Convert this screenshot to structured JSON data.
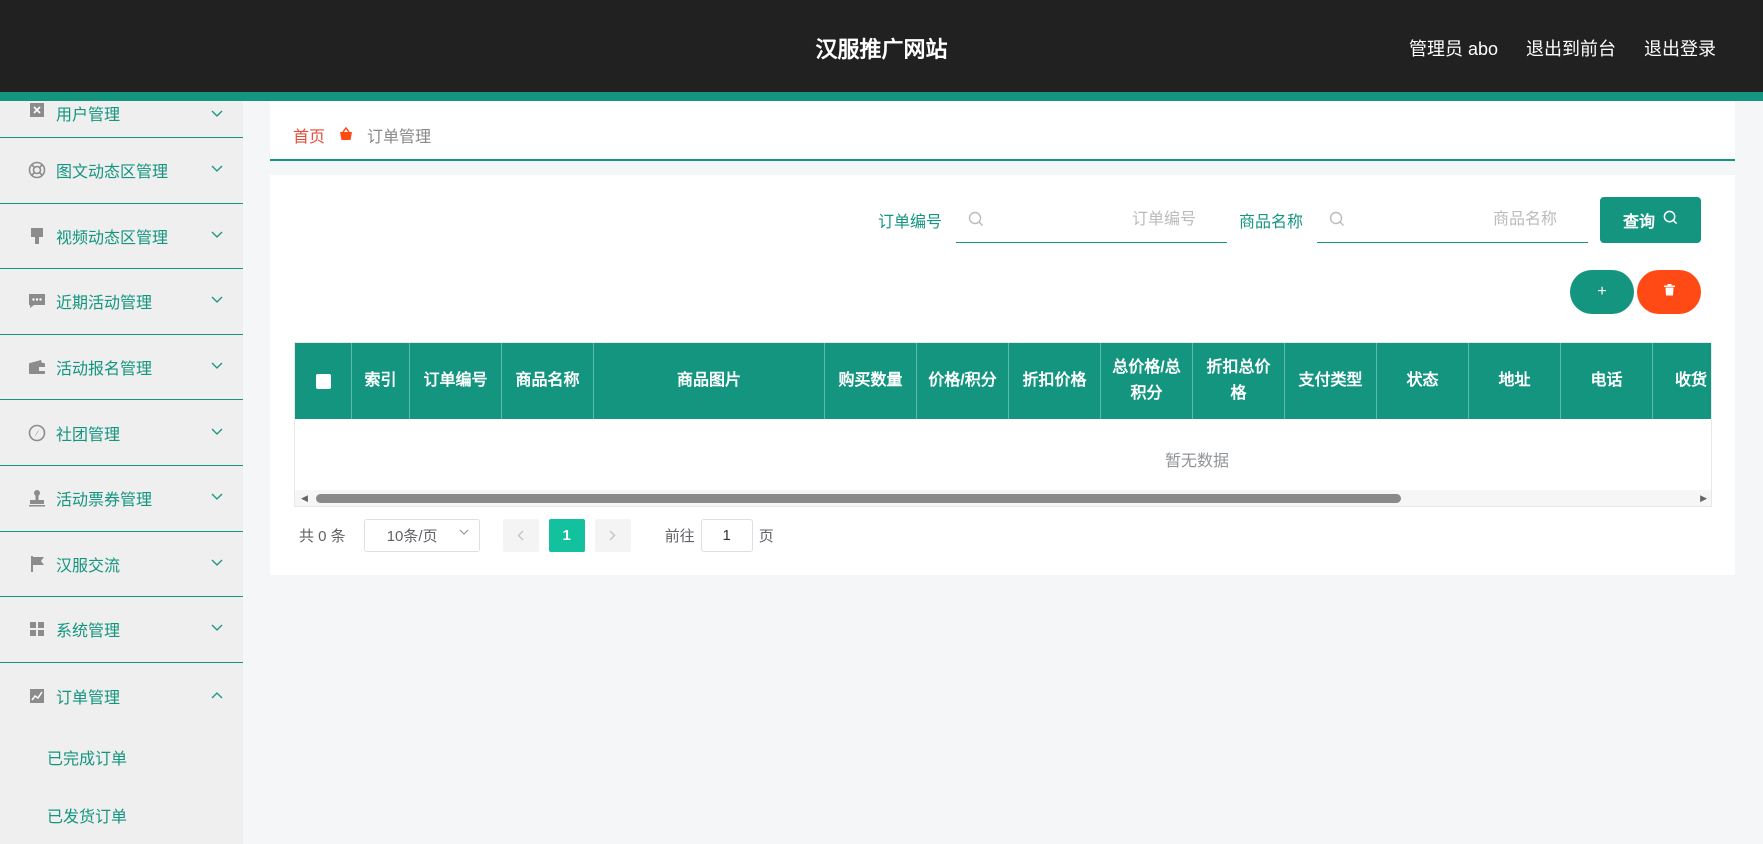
{
  "header": {
    "title": "汉服推广网站",
    "admin_label": "管理员 abo",
    "exit_front_label": "退出到前台",
    "logout_label": "退出登录"
  },
  "sidebar": {
    "items": [
      {
        "label": "用户管理",
        "icon": "user-box-icon",
        "expanded": false
      },
      {
        "label": "图文动态区管理",
        "icon": "lifebuoy-icon",
        "expanded": false
      },
      {
        "label": "视频动态区管理",
        "icon": "brush-icon",
        "expanded": false
      },
      {
        "label": "近期活动管理",
        "icon": "chat-icon",
        "expanded": false
      },
      {
        "label": "活动报名管理",
        "icon": "wallet-icon",
        "expanded": false
      },
      {
        "label": "社团管理",
        "icon": "compass-icon",
        "expanded": false
      },
      {
        "label": "活动票券管理",
        "icon": "stamp-icon",
        "expanded": false
      },
      {
        "label": "汉服交流",
        "icon": "flag-icon",
        "expanded": false
      },
      {
        "label": "系统管理",
        "icon": "grid-icon",
        "expanded": false
      },
      {
        "label": "订单管理",
        "icon": "trend-chart-icon",
        "expanded": true
      }
    ],
    "subitems": [
      {
        "label": "已完成订单"
      },
      {
        "label": "已发货订单"
      }
    ]
  },
  "breadcrumb": {
    "home": "首页",
    "current": "订单管理"
  },
  "search": {
    "order_no_label": "订单编号",
    "order_no_placeholder": "订单编号",
    "product_name_label": "商品名称",
    "product_name_placeholder": "商品名称",
    "query_label": "查询"
  },
  "actions": {
    "add_label": "+",
    "delete_icon": "trash-icon"
  },
  "table": {
    "columns": [
      "索引",
      "订单编号",
      "商品名称",
      "商品图片",
      "购买数量",
      "价格/积分",
      "折扣价格",
      "总价格/总积分",
      "折扣总价格",
      "支付类型",
      "状态",
      "地址",
      "电话",
      "收货"
    ],
    "empty_text": "暂无数据"
  },
  "pagination": {
    "total": "共 0 条",
    "page_size": "10条/页",
    "current_page": "1",
    "goto_label": "前往",
    "goto_value": "1",
    "page_unit": "页"
  },
  "colors": {
    "accent": "#13957f",
    "danger": "#ff4a16",
    "header_bg": "#212121"
  }
}
